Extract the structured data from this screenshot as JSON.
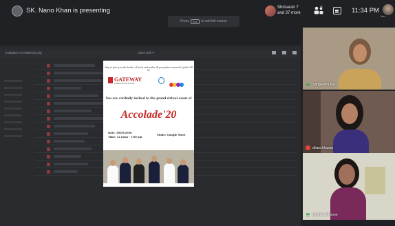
{
  "topbar": {
    "presenter_text": "SK. Nano Khan is presenting",
    "participant_name": "Shrisaran 7",
    "participant_more": "and 37 more",
    "people_count": "35",
    "time": "11:34 PM",
    "self_label": "You"
  },
  "fullscreen_hint": {
    "prefix": "Press",
    "key": "Esc",
    "suffix": "to exit full screen"
  },
  "shared_screen": {
    "file_name": "Invitation-Accolade'20.png",
    "open_with": "Open with ▾",
    "poster": {
      "header": "Way to give you the better of fresh and make all your plans ensured! (paths till it)",
      "school_name": "GATEWAY",
      "school_sub": "INTERNATIONAL SCHOOL",
      "invite_line": "You are cordially invited to the grand virtual event of",
      "event_title": "Accolade'20",
      "date_line": "Date: 30/05/2020",
      "time_line": "Time: 12 noon - 1:00 pm",
      "mode_line": "Mode: Google Meet"
    }
  },
  "tiles": [
    {
      "name": "Sangeetha Ms",
      "mic": "active"
    },
    {
      "name": "dhara khuspe",
      "mic": "muted"
    },
    {
      "name": "Lynette Johnson",
      "mic": "active"
    }
  ],
  "colors": {
    "background": "#202124",
    "accent_red": "#c62828",
    "mic_muted": "#ea4335",
    "mic_active": "#34a853"
  }
}
